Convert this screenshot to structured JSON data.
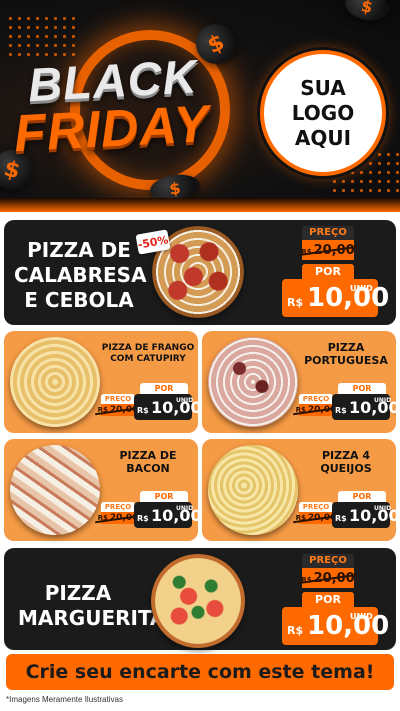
{
  "header": {
    "line1": "BLACK",
    "line2": "FRIDAY",
    "logo_line1": "SUA",
    "logo_line2": "LOGO",
    "logo_line3": "AQUI",
    "coin_symbol": "$"
  },
  "featured_top": {
    "name_line1": "PIZZA DE",
    "name_line2": "CALABRESA",
    "name_line3": "E CEBOLA",
    "discount": "-50%",
    "preco_label": "PREÇO",
    "old_currency": "R$",
    "old_price": "20,00",
    "por_label": "POR",
    "new_currency": "R$",
    "new_price": "10,00",
    "unit": "UNID"
  },
  "grid": [
    {
      "name_line1": "PIZZA DE FRANGO",
      "name_line2": "COM CATUPIRY",
      "preco_label": "PREÇO",
      "old_currency": "R$",
      "old_price": "20,00",
      "por_label": "POR",
      "new_currency": "R$",
      "new_price": "10,00",
      "unit": "UNID"
    },
    {
      "name_line1": "PIZZA",
      "name_line2": "PORTUGUESA",
      "preco_label": "PREÇO",
      "old_currency": "R$",
      "old_price": "20,00",
      "por_label": "POR",
      "new_currency": "R$",
      "new_price": "10,00",
      "unit": "UNID"
    },
    {
      "name_line1": "PIZZA DE",
      "name_line2": "BACON",
      "preco_label": "PREÇO",
      "old_currency": "R$",
      "old_price": "20,00",
      "por_label": "POR",
      "new_currency": "R$",
      "new_price": "10,00",
      "unit": "UNID"
    },
    {
      "name_line1": "PIZZA 4",
      "name_line2": "QUEIJOS",
      "preco_label": "PREÇO",
      "old_currency": "R$",
      "old_price": "20,00",
      "por_label": "POR",
      "new_currency": "R$",
      "new_price": "10,00",
      "unit": "UNID"
    }
  ],
  "featured_bottom": {
    "name_line1": "PIZZA",
    "name_line2": "MARGUERITA",
    "preco_label": "PREÇO",
    "old_currency": "R$",
    "old_price": "20,00",
    "por_label": "POR",
    "new_currency": "R$",
    "new_price": "10,00",
    "unit": "UNID"
  },
  "footer": {
    "cta": "Crie seu encarte com este tema!",
    "disclaimer": "*Imagens Meramente Ilustrativas"
  },
  "colors": {
    "accent": "#ff6a00",
    "dark": "#1b1b1b",
    "card_orange": "#f59a45"
  }
}
